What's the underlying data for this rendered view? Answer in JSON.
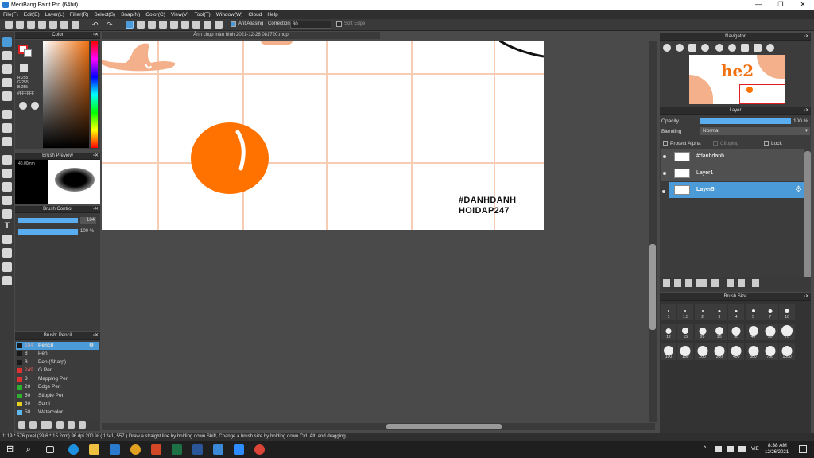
{
  "window": {
    "title": "MediBang Paint Pro (64bit)",
    "controls": [
      "—",
      "❐",
      "✕"
    ]
  },
  "menu": [
    "File(F)",
    "Edit(E)",
    "Layer(L)",
    "Filter(R)",
    "Select(S)",
    "Snap(N)",
    "Color(C)",
    "View(V)",
    "Tool(T)",
    "Window(W)",
    "Cloud",
    "Help"
  ],
  "toolbar": {
    "antialiasing": "AntiAliasing",
    "correction_label": "Correction",
    "correction_value": "30",
    "soft_edge": "Soft Edge"
  },
  "doc_tab": "Ảnh chụp màn hình 2021-12-26 081720.mdp",
  "color_panel": {
    "title": "Color",
    "r": "R:255",
    "g": "G:255",
    "b": "B:255",
    "hex": "#FFFFFF"
  },
  "brush_preview": {
    "title": "Brush Preview",
    "size": "40.00mm"
  },
  "brush_control": {
    "title": "Brush Control",
    "size": "184",
    "opacity": "100 %"
  },
  "brush_list": {
    "title": "Brush: Pencil",
    "items": [
      {
        "size": "184",
        "name": "Pencil",
        "color": "#1a1a1a"
      },
      {
        "size": "8",
        "name": "Pen",
        "color": "#1a1a1a"
      },
      {
        "size": "8",
        "name": "Pen (Sharp)",
        "color": "#1a1a1a"
      },
      {
        "size": "249",
        "name": "G Pen",
        "color": "#e03030"
      },
      {
        "size": "8",
        "name": "Mapping Pen",
        "color": "#e03030"
      },
      {
        "size": "20",
        "name": "Edge Pen",
        "color": "#30b030"
      },
      {
        "size": "50",
        "name": "Stipple Pen",
        "color": "#30b030"
      },
      {
        "size": "30",
        "name": "Sumi",
        "color": "#e8d020"
      },
      {
        "size": "50",
        "name": "Watercolor",
        "color": "#60b8f0"
      }
    ]
  },
  "canvas": {
    "text_line1": "#DANHDANH",
    "text_line2": "HOIDAP247"
  },
  "navigator": {
    "title": "Navigator"
  },
  "layer_panel": {
    "title": "Layer",
    "opacity_label": "Opacity",
    "opacity_value": "100 %",
    "opacity_fraction": 1.0,
    "blending_label": "Blending",
    "blending_value": "Normal",
    "protect_alpha": "Protect Alpha",
    "clipping": "Clipping",
    "lock": "Lock",
    "layers": [
      {
        "name": "#danhdanh",
        "selected": false
      },
      {
        "name": "Layer1",
        "selected": false
      },
      {
        "name": "Layer5",
        "selected": true
      }
    ]
  },
  "brush_size": {
    "title": "Brush Size",
    "sizes": [
      "1",
      "1.5",
      "2",
      "3",
      "4",
      "5",
      "7",
      "10",
      "12",
      "15",
      "20",
      "25",
      "30",
      "40",
      "50",
      "70",
      "100",
      "150",
      "200",
      "300",
      "400",
      "500",
      "700",
      "1000"
    ]
  },
  "status": "1119 * 576 pixel   (29.6 * 15.2cm)   96 dpi   200 %   ( 1241, 557 )   Draw a straight line by holding down Shift, Change a brush size by holding down Ctrl, Alt, and dragging",
  "taskbar": {
    "time": "8:38 AM",
    "date": "12/26/2021",
    "lang": "VIE"
  }
}
